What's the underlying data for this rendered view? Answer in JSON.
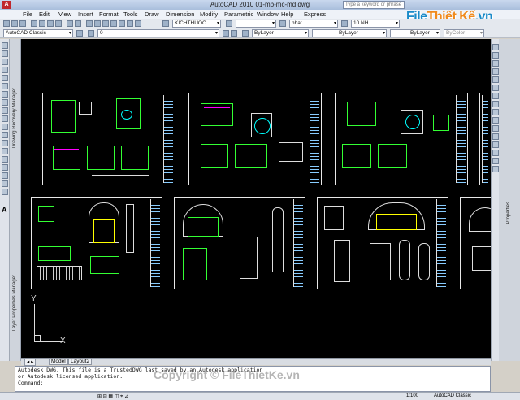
{
  "window": {
    "title": "AutoCAD 2010    01-mb-mc-md.dwg",
    "logo": "A",
    "search_placeholder": "Type a keyword or phrase"
  },
  "menu": [
    "File",
    "Edit",
    "View",
    "Insert",
    "Format",
    "Tools",
    "Draw",
    "Dimension",
    "Modify",
    "Parametric",
    "Window",
    "Help",
    "Express"
  ],
  "watermark": {
    "part1": "File",
    "part2": "Thiết Kế",
    "part3": ".vn"
  },
  "toolbar1": {
    "workspace": "AutoCAD Classic",
    "style_small": "KICHTHUOC",
    "layer": "nhat",
    "dim_scale": "10 NH"
  },
  "toolbar2": {
    "layer_combo": "0",
    "color": "ByLayer",
    "linetype": "ByLayer",
    "lineweight": "ByLayer",
    "plotstyle": "ByColor"
  },
  "palettes": {
    "left_top": "Drawing Recovery Manager",
    "left_bottom": "Layer Properties Manager",
    "right": "Properties"
  },
  "axis": {
    "y": "Y",
    "x": "X"
  },
  "tabs": {
    "model": "Model",
    "layout2": "Layout2"
  },
  "command": {
    "line1": "Autodesk DWG.  This file is a TrustedDWG last saved by an Autodesk application",
    "line2": "or Autodesk licensed application.",
    "prompt": "Command:"
  },
  "copyright": "Copyright © FileThietKe.vn",
  "status": {
    "scale": "1:100",
    "workspace": "AutoCAD Classic"
  }
}
